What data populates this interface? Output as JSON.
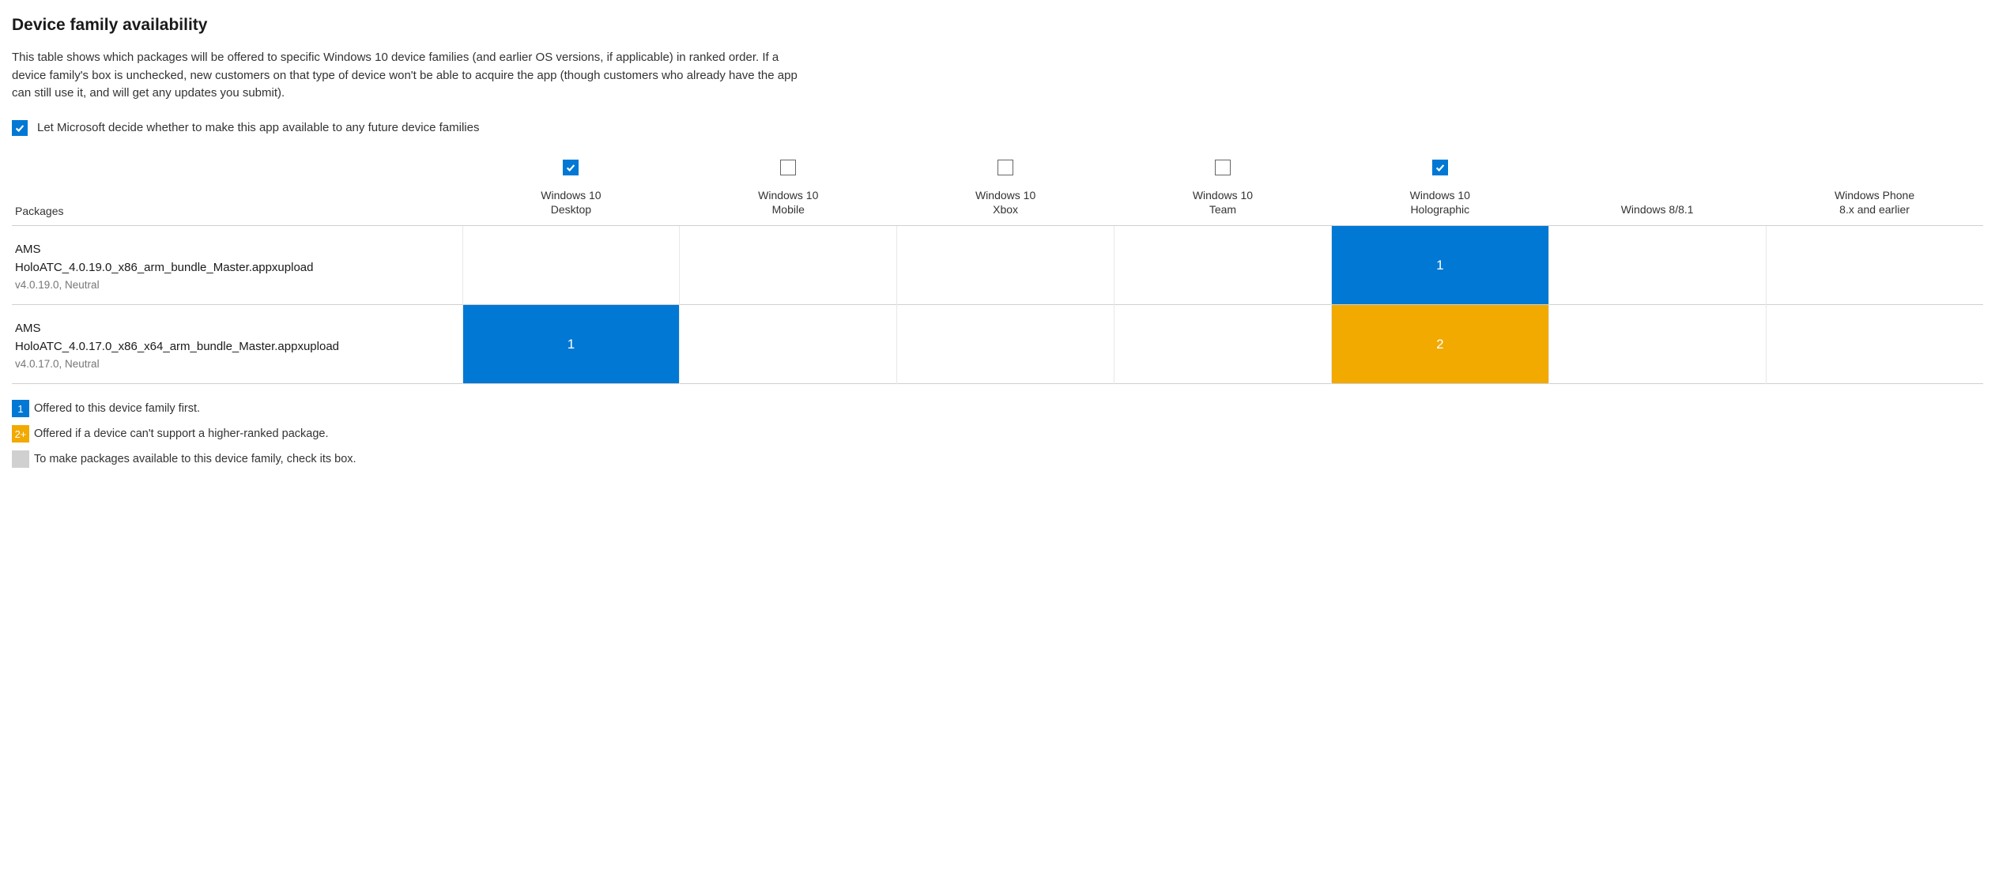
{
  "heading": "Device family availability",
  "description": "This table shows which packages will be offered to specific Windows 10 device families (and earlier OS versions, if applicable) in ranked order. If a device family's box is unchecked, new customers on that type of device won't be able to acquire the app (though customers who already have the app can still use it, and will get any updates you submit).",
  "future_checkbox_label": "Let Microsoft decide whether to make this app available to any future device families",
  "future_checkbox_checked": true,
  "packages_header": "Packages",
  "columns": [
    {
      "label_l1": "Windows 10",
      "label_l2": "Desktop",
      "has_checkbox": true,
      "checked": true
    },
    {
      "label_l1": "Windows 10",
      "label_l2": "Mobile",
      "has_checkbox": true,
      "checked": false
    },
    {
      "label_l1": "Windows 10",
      "label_l2": "Xbox",
      "has_checkbox": true,
      "checked": false
    },
    {
      "label_l1": "Windows 10",
      "label_l2": "Team",
      "has_checkbox": true,
      "checked": false
    },
    {
      "label_l1": "Windows 10",
      "label_l2": "Holographic",
      "has_checkbox": true,
      "checked": true
    },
    {
      "label_l1": "Windows 8/8.1",
      "label_l2": "",
      "has_checkbox": false,
      "checked": false
    },
    {
      "label_l1": "Windows Phone",
      "label_l2": "8.x and earlier",
      "has_checkbox": false,
      "checked": false
    }
  ],
  "rows": [
    {
      "name_l1": "AMS",
      "name_l2": "HoloATC_4.0.19.0_x86_arm_bundle_Master.appxupload",
      "meta": "v4.0.19.0, Neutral",
      "ranks": [
        null,
        null,
        null,
        null,
        1,
        null,
        null
      ]
    },
    {
      "name_l1": "AMS",
      "name_l2": "HoloATC_4.0.17.0_x86_x64_arm_bundle_Master.appxupload",
      "meta": "v4.0.17.0, Neutral",
      "ranks": [
        1,
        null,
        null,
        null,
        2,
        null,
        null
      ]
    }
  ],
  "legend": [
    {
      "swatch": "1",
      "swatch_class": "swatch-1",
      "text": "Offered to this device family first."
    },
    {
      "swatch": "2+",
      "swatch_class": "swatch-2",
      "text": "Offered if a device can't support a higher-ranked package."
    },
    {
      "swatch": "",
      "swatch_class": "swatch-grey",
      "text": "To make packages available to this device family, check its box."
    }
  ],
  "colors": {
    "primary": "#0078D4",
    "secondary": "#F2A900"
  }
}
